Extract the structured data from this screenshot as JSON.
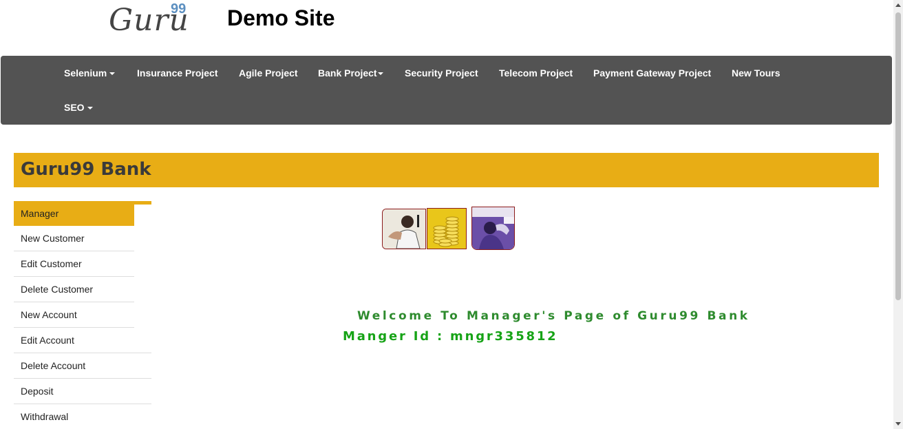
{
  "header": {
    "logo_text": "Guru",
    "logo_superscript": "99",
    "site_title": "Demo Site"
  },
  "navbar": {
    "items": [
      {
        "label": "Selenium",
        "dropdown": true
      },
      {
        "label": "Insurance Project",
        "dropdown": false
      },
      {
        "label": "Agile Project",
        "dropdown": false
      },
      {
        "label": "Bank Project",
        "dropdown": true
      },
      {
        "label": "Security Project",
        "dropdown": false
      },
      {
        "label": "Telecom Project",
        "dropdown": false
      },
      {
        "label": "Payment Gateway Project",
        "dropdown": false
      },
      {
        "label": "New Tours",
        "dropdown": false
      },
      {
        "label": "SEO",
        "dropdown": true
      }
    ]
  },
  "banner": {
    "title": "Guru99 Bank"
  },
  "sidebar": {
    "active": "Manager",
    "items": [
      "New Customer",
      "Edit Customer",
      "Delete Customer",
      "New Account",
      "Edit Account",
      "Delete Account",
      "Deposit",
      "Withdrawal"
    ]
  },
  "main": {
    "welcome_text": "Welcome To Manager's Page of Guru99 Bank",
    "manager_id_text": "Manger Id : mngr335812"
  },
  "colors": {
    "accent": "#e8ad15",
    "navbar": "#535353",
    "welcome": "#2e8b2e"
  }
}
